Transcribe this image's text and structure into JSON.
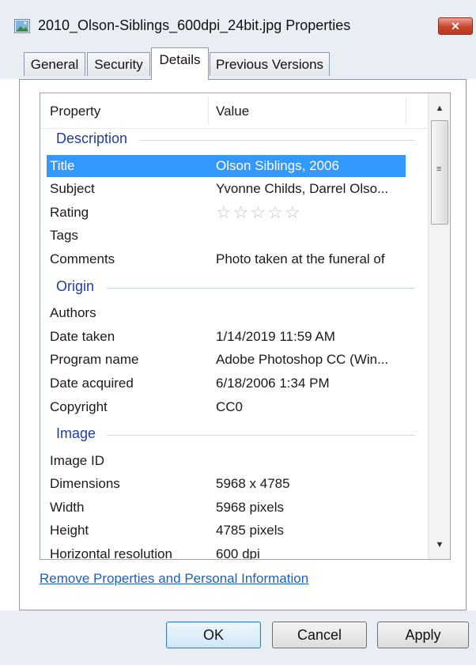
{
  "window": {
    "title": "2010_Olson-Siblings_600dpi_24bit.jpg Properties",
    "close_label": "✕"
  },
  "tabs": [
    {
      "label": "General"
    },
    {
      "label": "Security"
    },
    {
      "label": "Details",
      "active": true
    },
    {
      "label": "Previous Versions"
    }
  ],
  "table": {
    "headers": {
      "property": "Property",
      "value": "Value"
    },
    "groups": {
      "description": "Description",
      "origin": "Origin",
      "image": "Image"
    },
    "rows": [
      {
        "property": "Title",
        "value": "Olson Siblings, 2006",
        "selected": true
      },
      {
        "property": "Subject",
        "value": "Yvonne Childs, Darrel Olso..."
      },
      {
        "property": "Rating",
        "value": ""
      },
      {
        "property": "Tags",
        "value": ""
      },
      {
        "property": "Comments",
        "value": "Photo taken at the funeral of"
      },
      {
        "property": "Authors",
        "value": ""
      },
      {
        "property": "Date taken",
        "value": "1/14/2019 11:59 AM"
      },
      {
        "property": "Program name",
        "value": "Adobe Photoshop CC (Win..."
      },
      {
        "property": "Date acquired",
        "value": "6/18/2006 1:34 PM"
      },
      {
        "property": "Copyright",
        "value": "CC0"
      },
      {
        "property": "Image ID",
        "value": ""
      },
      {
        "property": "Dimensions",
        "value": "5968 x 4785"
      },
      {
        "property": "Width",
        "value": "5968 pixels"
      },
      {
        "property": "Height",
        "value": "4785 pixels"
      },
      {
        "property": "Horizontal resolution",
        "value": "600 dpi"
      }
    ],
    "rating_stars": {
      "filled": 0,
      "total": 5,
      "symbol": "☆"
    }
  },
  "scrollbar": {
    "up_arrow": "▲",
    "down_arrow": "▼",
    "grip": "≡"
  },
  "link": {
    "label": "Remove Properties and Personal Information"
  },
  "buttons": {
    "ok": "OK",
    "cancel": "Cancel",
    "apply": "Apply"
  },
  "colors": {
    "selection": "#3399ff",
    "group_heading": "#1e3f9a",
    "link": "#1f5fb8"
  }
}
